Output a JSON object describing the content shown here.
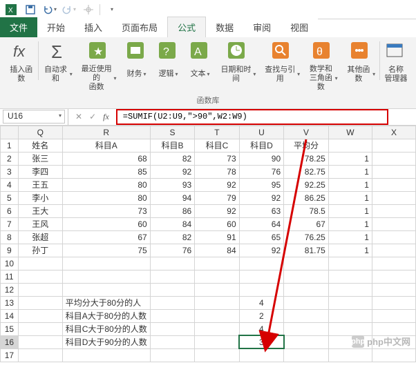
{
  "titlebar": {
    "save_icon": "save-icon",
    "undo_icon": "undo-icon",
    "redo_icon": "redo-icon",
    "touch_icon": "touch-icon",
    "dd_icon": "dropdown-icon"
  },
  "tabs": {
    "file": "文件",
    "home": "开始",
    "insert": "插入",
    "layout": "页面布局",
    "formula": "公式",
    "data": "数据",
    "review": "审阅",
    "view": "视图"
  },
  "ribbon": {
    "insert_fn": "插入函数",
    "autosum": "自动求和",
    "recent": "最近使用的\n函数",
    "finance": "财务",
    "logic": "逻辑",
    "text": "文本",
    "datetime": "日期和时间",
    "lookup": "查找与引用",
    "math": "数学和\n三角函数",
    "other": "其他函数",
    "name_mgr": "名称\n管理器",
    "group_caption": "函数库"
  },
  "namebox": "U16",
  "formula": "=SUMIF(U2:U9,\">90\",W2:W9)",
  "columns": [
    "",
    "Q",
    "R",
    "S",
    "T",
    "U",
    "V",
    "W",
    "X"
  ],
  "rows": [
    {
      "n": "1",
      "Q": "姓名",
      "R": "科目A",
      "S": "科目B",
      "T": "科目C",
      "U": "科目D",
      "V": "平均分",
      "W": "",
      "X": ""
    },
    {
      "n": "2",
      "Q": "张三",
      "R": "68",
      "S": "82",
      "T": "73",
      "U": "90",
      "V": "78.25",
      "W": "1",
      "X": ""
    },
    {
      "n": "3",
      "Q": "李四",
      "R": "85",
      "S": "92",
      "T": "78",
      "U": "76",
      "V": "82.75",
      "W": "1",
      "X": ""
    },
    {
      "n": "4",
      "Q": "王五",
      "R": "80",
      "S": "93",
      "T": "92",
      "U": "95",
      "V": "92.25",
      "W": "1",
      "X": ""
    },
    {
      "n": "5",
      "Q": "李小",
      "R": "80",
      "S": "94",
      "T": "79",
      "U": "92",
      "V": "86.25",
      "W": "1",
      "X": ""
    },
    {
      "n": "6",
      "Q": "王大",
      "R": "73",
      "S": "86",
      "T": "92",
      "U": "63",
      "V": "78.5",
      "W": "1",
      "X": ""
    },
    {
      "n": "7",
      "Q": "王风",
      "R": "60",
      "S": "84",
      "T": "60",
      "U": "64",
      "V": "67",
      "W": "1",
      "X": ""
    },
    {
      "n": "8",
      "Q": "张超",
      "R": "67",
      "S": "82",
      "T": "91",
      "U": "65",
      "V": "76.25",
      "W": "1",
      "X": ""
    },
    {
      "n": "9",
      "Q": "孙丁",
      "R": "75",
      "S": "76",
      "T": "84",
      "U": "92",
      "V": "81.75",
      "W": "1",
      "X": ""
    },
    {
      "n": "10",
      "Q": "",
      "R": "",
      "S": "",
      "T": "",
      "U": "",
      "V": "",
      "W": "",
      "X": ""
    },
    {
      "n": "11",
      "Q": "",
      "R": "",
      "S": "",
      "T": "",
      "U": "",
      "V": "",
      "W": "",
      "X": ""
    },
    {
      "n": "12",
      "Q": "",
      "R": "",
      "S": "",
      "T": "",
      "U": "",
      "V": "",
      "W": "",
      "X": ""
    },
    {
      "n": "13",
      "Q": "",
      "R": "平均分大于80分的人",
      "S": "",
      "T": "",
      "U": "4",
      "V": "",
      "W": "",
      "X": ""
    },
    {
      "n": "14",
      "Q": "",
      "R": "科目A大于80分的人数",
      "S": "",
      "T": "",
      "U": "2",
      "V": "",
      "W": "",
      "X": ""
    },
    {
      "n": "15",
      "Q": "",
      "R": "科目C大于80分的人数",
      "S": "",
      "T": "",
      "U": "4",
      "V": "",
      "W": "",
      "X": ""
    },
    {
      "n": "16",
      "Q": "",
      "R": "科目D大于90分的人数",
      "S": "",
      "T": "",
      "U": "3",
      "V": "",
      "W": "",
      "X": ""
    },
    {
      "n": "17",
      "Q": "",
      "R": "",
      "S": "",
      "T": "",
      "U": "",
      "V": "",
      "W": "",
      "X": ""
    }
  ],
  "selected": {
    "row": "16",
    "col": "U"
  },
  "watermark": "php中文网"
}
